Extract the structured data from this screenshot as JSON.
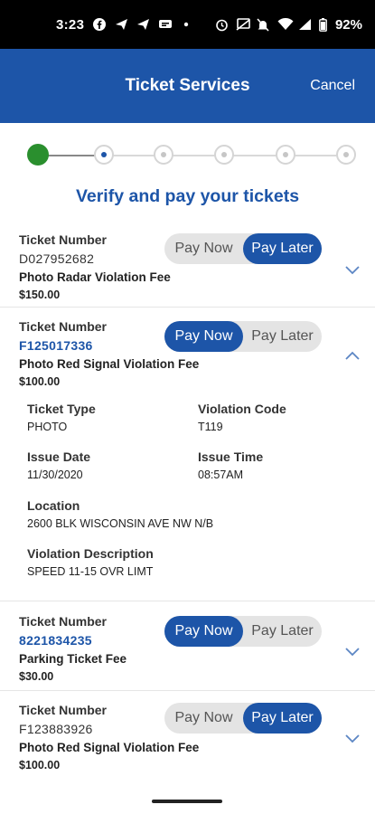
{
  "status_bar": {
    "time": "3:23",
    "battery": "92%",
    "left_icons": [
      "facebook-icon",
      "send-icon",
      "send-icon",
      "chat-icon",
      "dot-icon"
    ],
    "right_icons": [
      "alarm-icon",
      "cast-icon",
      "mute-icon",
      "wifi-icon",
      "signal-icon",
      "battery-icon"
    ]
  },
  "header": {
    "title": "Ticket Services",
    "cancel_label": "Cancel",
    "background_color": "#1d55a8"
  },
  "stepper": {
    "total_steps": 6,
    "completed_steps": 1,
    "current_step": 2,
    "completed_color": "#2a8f2e",
    "current_color": "#1d55a8"
  },
  "page_title": "Verify and pay your tickets",
  "tickets": [
    {
      "number_label": "Ticket Number",
      "number": "D027952682",
      "fee_type": "Photo Radar Violation Fee",
      "amount": "$150.00",
      "pay_now_label": "Pay Now",
      "pay_later_label": "Pay Later",
      "selected": "Pay Later",
      "expanded": false
    },
    {
      "number_label": "Ticket Number",
      "number": "F125017336",
      "fee_type": "Photo Red Signal Violation Fee",
      "amount": "$100.00",
      "pay_now_label": "Pay Now",
      "pay_later_label": "Pay Later",
      "selected": "Pay Now",
      "expanded": true,
      "details": {
        "ticket_type_label": "Ticket Type",
        "ticket_type": "PHOTO",
        "violation_code_label": "Violation Code",
        "violation_code": "T119",
        "issue_date_label": "Issue Date",
        "issue_date": "11/30/2020",
        "issue_time_label": "Issue Time",
        "issue_time": "08:57AM",
        "location_label": "Location",
        "location": "2600 BLK WISCONSIN AVE NW N/B",
        "violation_description_label": "Violation Description",
        "violation_description": "SPEED 11-15 OVR LIMT"
      }
    },
    {
      "number_label": "Ticket Number",
      "number": "8221834235",
      "fee_type": "Parking Ticket Fee",
      "amount": "$30.00",
      "pay_now_label": "Pay Now",
      "pay_later_label": "Pay Later",
      "selected": "Pay Now",
      "expanded": false
    },
    {
      "number_label": "Ticket Number",
      "number": "F123883926",
      "fee_type": "Photo Red Signal Violation Fee",
      "amount": "$100.00",
      "pay_now_label": "Pay Now",
      "pay_later_label": "Pay Later",
      "selected": "Pay Later",
      "expanded": false
    }
  ]
}
